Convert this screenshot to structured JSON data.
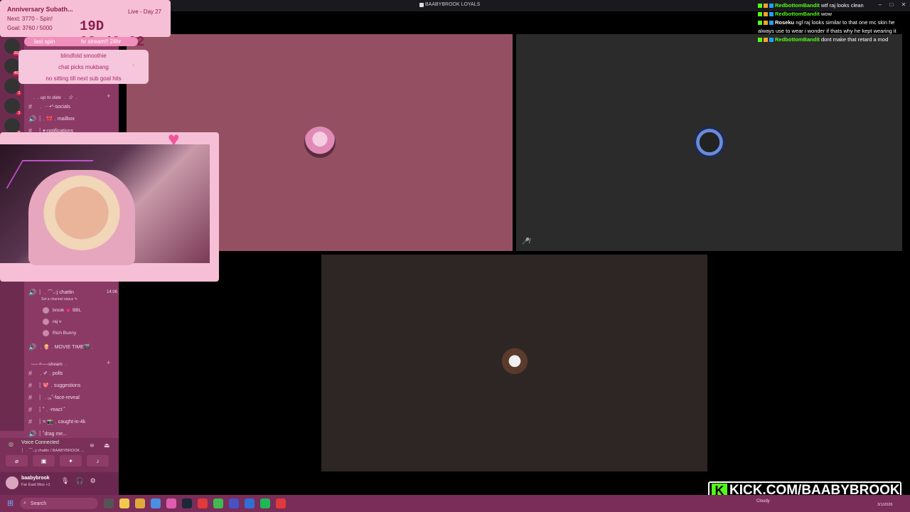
{
  "window": {
    "title": "BAABYBROOK LOYALS",
    "controls": [
      "–",
      "□",
      "✕"
    ]
  },
  "overlay": {
    "subathon_title": "Anniversary Subath...",
    "next": "Next: 3770 - Spin!",
    "goal": "Goal: 3760 / 5000",
    "live": "Live - Day 27",
    "timer": "19D 08:49:02",
    "last_spin": "last spin",
    "hr_stream": "hr stream!! 24hr",
    "spin_items": [
      "blindfold smoothie",
      "chat picks mukbang",
      "no sitting till next sub goal hits"
    ]
  },
  "sidebar": {
    "server_badges": [
      "8",
      "263",
      "3",
      "3",
      "483"
    ],
    "categories": {
      "up_to_date": "﹒﹒up to date ﹒ ☆ ﹒",
      "stream": "──✧──stream ﹒"
    },
    "channels_top": [
      {
        "icon": "#",
        "label": "﹒ ┈•°-socials"
      },
      {
        "icon": "🔊",
        "label": "┆﹒🎀﹒mailbox"
      },
      {
        "icon": "#",
        "label": "┆ ▾-notifications"
      }
    ],
    "voice_channel": {
      "label": "┆ ﹒⌒₊:j chattin",
      "time": "14:06",
      "status": "Set a channel status ✎"
    },
    "members": [
      {
        "name": "brook 💗 BBL"
      },
      {
        "name": "raj v"
      },
      {
        "name": "Rich Bunny"
      }
    ],
    "movie": "﹒🍿﹒MOVIE TIME🎬﹒",
    "channels_stream": [
      {
        "icon": "#",
        "label": "﹒✐﹒polls"
      },
      {
        "icon": "#",
        "label": "┆ 💖﹒suggestions"
      },
      {
        "icon": "#",
        "label": "┆ ﹒ₒᵤ˚-face-reveal"
      },
      {
        "icon": "#",
        "label": "┆ ˚﹒‑react ˚"
      },
      {
        "icon": "#",
        "label": "┆ ⌗ 📸﹒caught-in-4k"
      },
      {
        "icon": "🔊",
        "label": "┆ ˚drag me..."
      }
    ],
    "voice": {
      "connected": "Voice Connected",
      "sub": "┆ ﹒⌒₊:j chattin / BAABYBROOK ..."
    },
    "user": {
      "name": "baabybrook",
      "status": "Far East Mos +1"
    }
  },
  "chat": [
    {
      "user": "RedbottomBandit",
      "text": "wtf raj looks clean",
      "color": "#53fc18"
    },
    {
      "user": "RedbottomBandit",
      "text": "wow",
      "color": "#53fc18"
    },
    {
      "user": "Roseku",
      "text": "ngl raj looks similar to that one mc skin he always use to wear i wonder if thats why he kept wearing it",
      "color": "#ffffff"
    },
    {
      "user": "RedbottomBandit",
      "text": "dont make that retard a mod",
      "color": "#53fc18"
    }
  ],
  "kick": {
    "url": "KICK.COM/BAABYBROOK"
  },
  "taskbar": {
    "search_placeholder": "Search",
    "weather": "Cloudy",
    "date": "3/1/2026"
  },
  "colors": {
    "accent_pink": "#f6bfd6",
    "discord_sidebar": "#8b3a66",
    "kick_green": "#53fc18"
  }
}
